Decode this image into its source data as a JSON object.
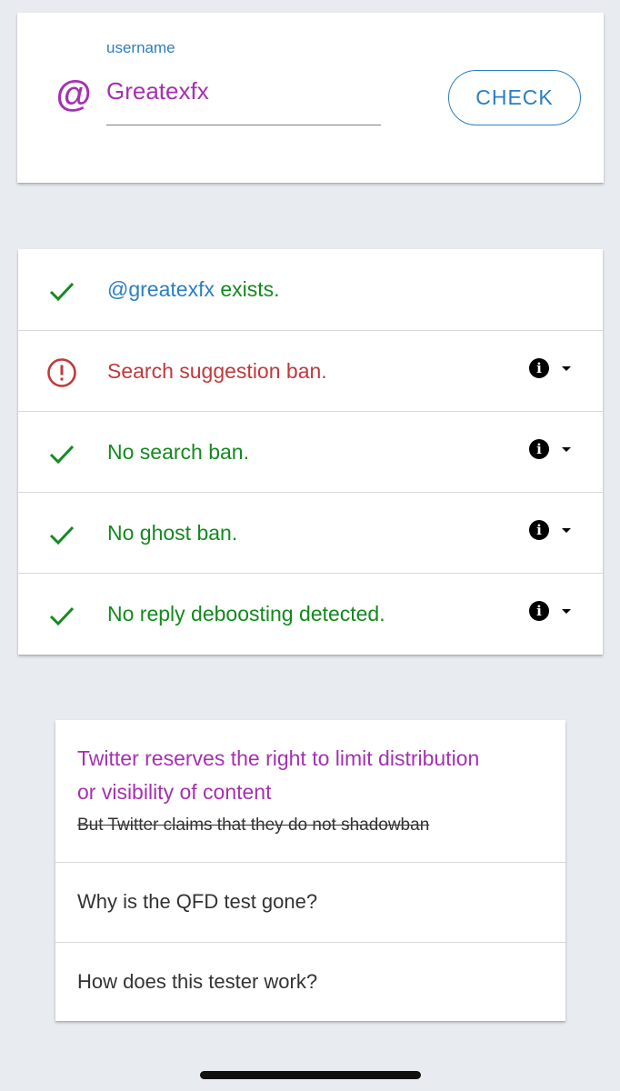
{
  "search": {
    "at_symbol": "@",
    "label": "username",
    "value": "Greatexfx",
    "button_label": "CHECK"
  },
  "results": [
    {
      "status": "ok",
      "handle": "@greatexfx",
      "text": " exists.",
      "has_info": false
    },
    {
      "status": "warning",
      "text": "Search suggestion ban.",
      "has_info": true
    },
    {
      "status": "ok",
      "text": "No search ban.",
      "has_info": true
    },
    {
      "status": "ok",
      "text": "No ghost ban.",
      "has_info": true
    },
    {
      "status": "ok",
      "text": "No reply deboosting detected.",
      "has_info": true
    }
  ],
  "info_glyph": "i",
  "faq": {
    "title_line1": "Twitter reserves the right to limit distribution",
    "title_line2": "or visibility of content",
    "struck_text": "But Twitter claims that they do not shadowban",
    "q1": "Why is the QFD test gone?",
    "q2": "How does this tester work?"
  },
  "colors": {
    "accent_purple": "#a531b0",
    "accent_blue": "#2b7fc0",
    "success_green": "#138a1f",
    "error_red": "#c0393b",
    "background": "#e8ecf1"
  },
  "icons": {
    "username": "at-icon",
    "ok": "check-icon",
    "warning": "alert-circle-icon",
    "info": "info-icon",
    "expand": "caret-down-icon"
  }
}
